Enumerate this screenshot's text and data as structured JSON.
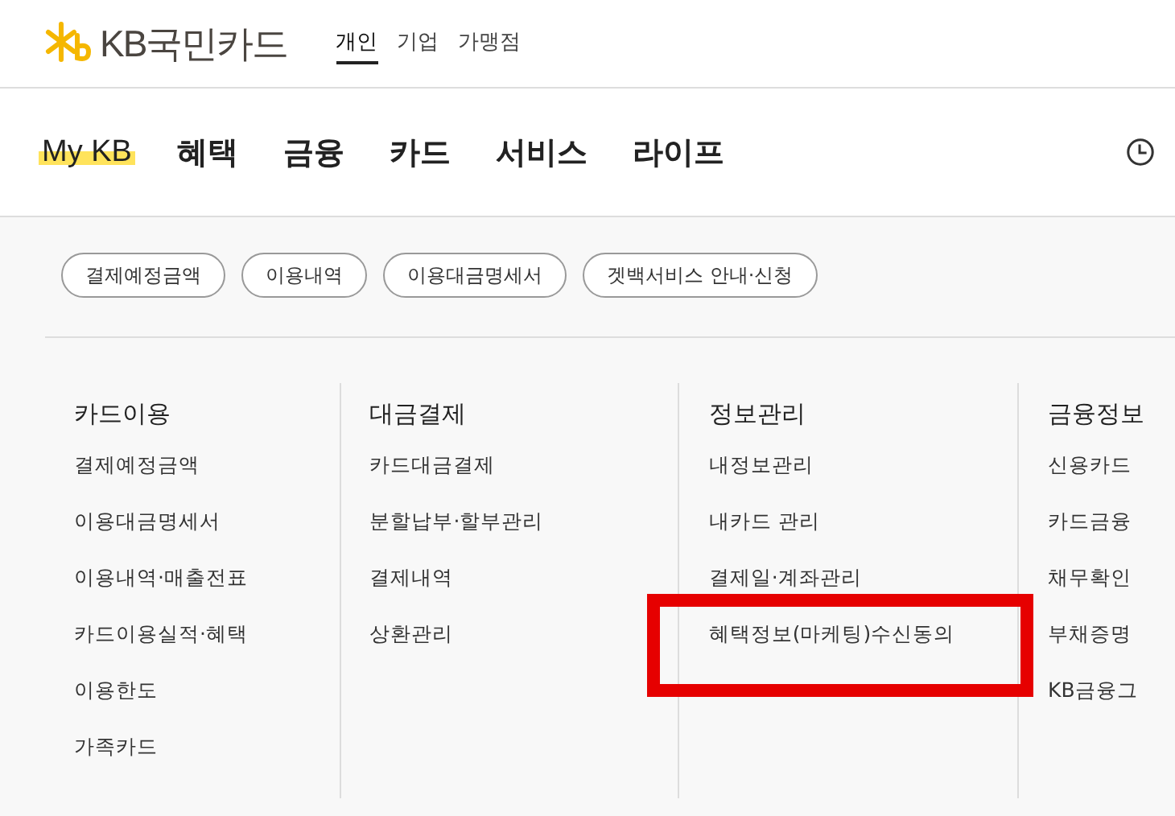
{
  "header": {
    "logo_text": "KB국민카드",
    "segments": [
      {
        "label": "개인",
        "selected": true
      },
      {
        "label": "기업",
        "selected": false
      },
      {
        "label": "가맹점",
        "selected": false
      }
    ]
  },
  "main_menu": [
    {
      "label": "My KB",
      "selected": true
    },
    {
      "label": "혜택",
      "selected": false
    },
    {
      "label": "금융",
      "selected": false
    },
    {
      "label": "카드",
      "selected": false
    },
    {
      "label": "서비스",
      "selected": false
    },
    {
      "label": "라이프",
      "selected": false
    }
  ],
  "quick_links": [
    "결제예정금액",
    "이용내역",
    "이용대금명세서",
    "겟백서비스 안내·신청"
  ],
  "columns": [
    {
      "title": "카드이용",
      "items": [
        {
          "label": "결제예정금액",
          "highlighted": false
        },
        {
          "label": "이용대금명세서",
          "highlighted": false
        },
        {
          "label": "이용내역·매출전표",
          "highlighted": false
        },
        {
          "label": "카드이용실적·혜택",
          "highlighted": false
        },
        {
          "label": "이용한도",
          "highlighted": false
        },
        {
          "label": "가족카드",
          "highlighted": false
        }
      ]
    },
    {
      "title": "대금결제",
      "items": [
        {
          "label": "카드대금결제",
          "highlighted": false
        },
        {
          "label": "분할납부·할부관리",
          "highlighted": false
        },
        {
          "label": "결제내역",
          "highlighted": false
        },
        {
          "label": "상환관리",
          "highlighted": false
        }
      ]
    },
    {
      "title": "정보관리",
      "items": [
        {
          "label": "내정보관리",
          "highlighted": false
        },
        {
          "label": "내카드 관리",
          "highlighted": false
        },
        {
          "label": "결제일·계좌관리",
          "highlighted": false
        },
        {
          "label": "혜택정보(마케팅)수신동의",
          "highlighted": true
        }
      ]
    },
    {
      "title": "금융정보",
      "items": [
        {
          "label": "신용카드",
          "highlighted": false
        },
        {
          "label": "카드금융",
          "highlighted": false
        },
        {
          "label": "채무확인",
          "highlighted": false
        },
        {
          "label": "부채증명",
          "highlighted": false
        },
        {
          "label": "KB금융그",
          "highlighted": false
        }
      ]
    }
  ]
}
